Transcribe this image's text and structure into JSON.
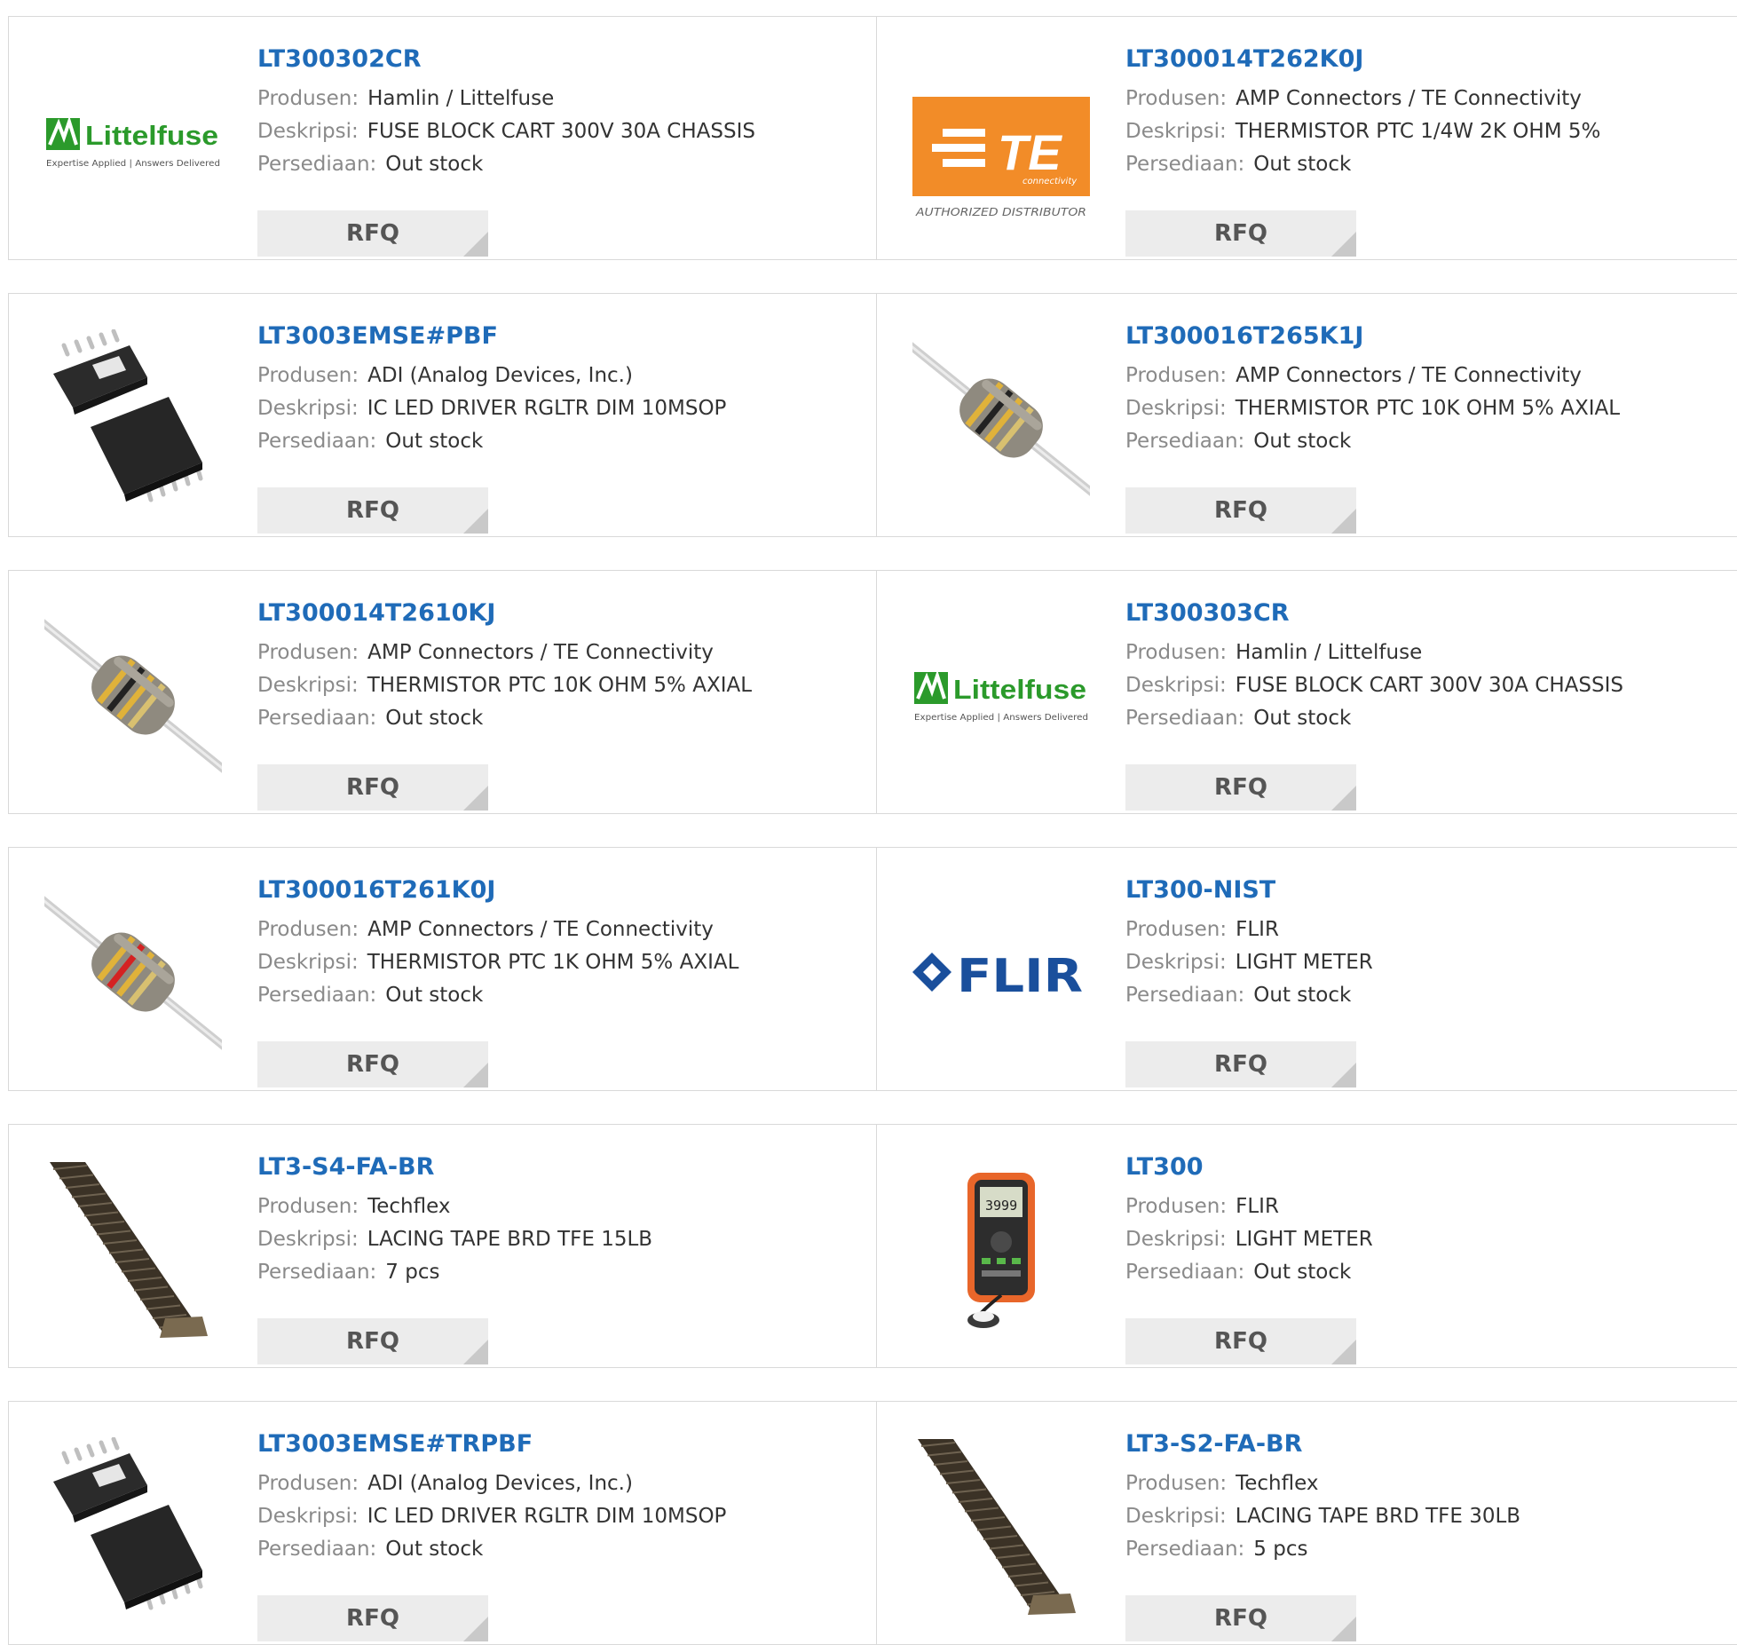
{
  "labels": {
    "manufacturer": "Produsen:",
    "description": "Deskripsi:",
    "stock": "Persediaan:",
    "rfq": "RFQ"
  },
  "products": [
    {
      "part": "LT300302CR",
      "manufacturer": "Hamlin / Littelfuse",
      "description": "FUSE BLOCK CART 300V 30A CHASSIS",
      "stock": "Out stock",
      "image": "littelfuse-logo"
    },
    {
      "part": "LT300014T262K0J",
      "manufacturer": "AMP Connectors / TE Connectivity",
      "description": "THERMISTOR PTC 1/4W 2K OHM 5%",
      "stock": "Out stock",
      "image": "te-connectivity-logo"
    },
    {
      "part": "LT3003EMSE#PBF",
      "manufacturer": "ADI (Analog Devices, Inc.)",
      "description": "IC LED DRIVER RGLTR DIM 10MSOP",
      "stock": "Out stock",
      "image": "msop-chip"
    },
    {
      "part": "LT300016T265K1J",
      "manufacturer": "AMP Connectors / TE Connectivity",
      "description": "THERMISTOR PTC 10K OHM 5% AXIAL",
      "stock": "Out stock",
      "image": "axial-thermistor"
    },
    {
      "part": "LT300014T2610KJ",
      "manufacturer": "AMP Connectors / TE Connectivity",
      "description": "THERMISTOR PTC 10K OHM 5% AXIAL",
      "stock": "Out stock",
      "image": "axial-thermistor"
    },
    {
      "part": "LT300303CR",
      "manufacturer": "Hamlin / Littelfuse",
      "description": "FUSE BLOCK CART 300V 30A CHASSIS",
      "stock": "Out stock",
      "image": "littelfuse-logo"
    },
    {
      "part": "LT300016T261K0J",
      "manufacturer": "AMP Connectors / TE Connectivity",
      "description": "THERMISTOR PTC 1K OHM 5% AXIAL",
      "stock": "Out stock",
      "image": "axial-thermistor-red"
    },
    {
      "part": "LT300-NIST",
      "manufacturer": "FLIR",
      "description": "LIGHT METER",
      "stock": "Out stock",
      "image": "flir-logo"
    },
    {
      "part": "LT3-S4-FA-BR",
      "manufacturer": "Techflex",
      "description": "LACING TAPE BRD TFE 15LB",
      "stock": "7 pcs",
      "image": "braided-tape"
    },
    {
      "part": "LT300",
      "manufacturer": "FLIR",
      "description": "LIGHT METER",
      "stock": "Out stock",
      "image": "light-meter"
    },
    {
      "part": "LT3003EMSE#TRPBF",
      "manufacturer": "ADI (Analog Devices, Inc.)",
      "description": "IC LED DRIVER RGLTR DIM 10MSOP",
      "stock": "Out stock",
      "image": "msop-chip"
    },
    {
      "part": "LT3-S2-FA-BR",
      "manufacturer": "Techflex",
      "description": "LACING TAPE BRD TFE 30LB",
      "stock": "5 pcs",
      "image": "braided-tape"
    }
  ],
  "logos": {
    "littelfuse": {
      "name": "Littelfuse",
      "tagline": "Expertise Applied | Answers Delivered",
      "color": "#2b9a2b"
    },
    "te": {
      "name": "TE",
      "sub": "connectivity",
      "caption": "AUTHORIZED DISTRIBUTOR",
      "color": "#f28c28"
    },
    "flir": {
      "name": "FLIR",
      "color": "#1a4f9c"
    },
    "meter": {
      "display": "3999"
    }
  }
}
